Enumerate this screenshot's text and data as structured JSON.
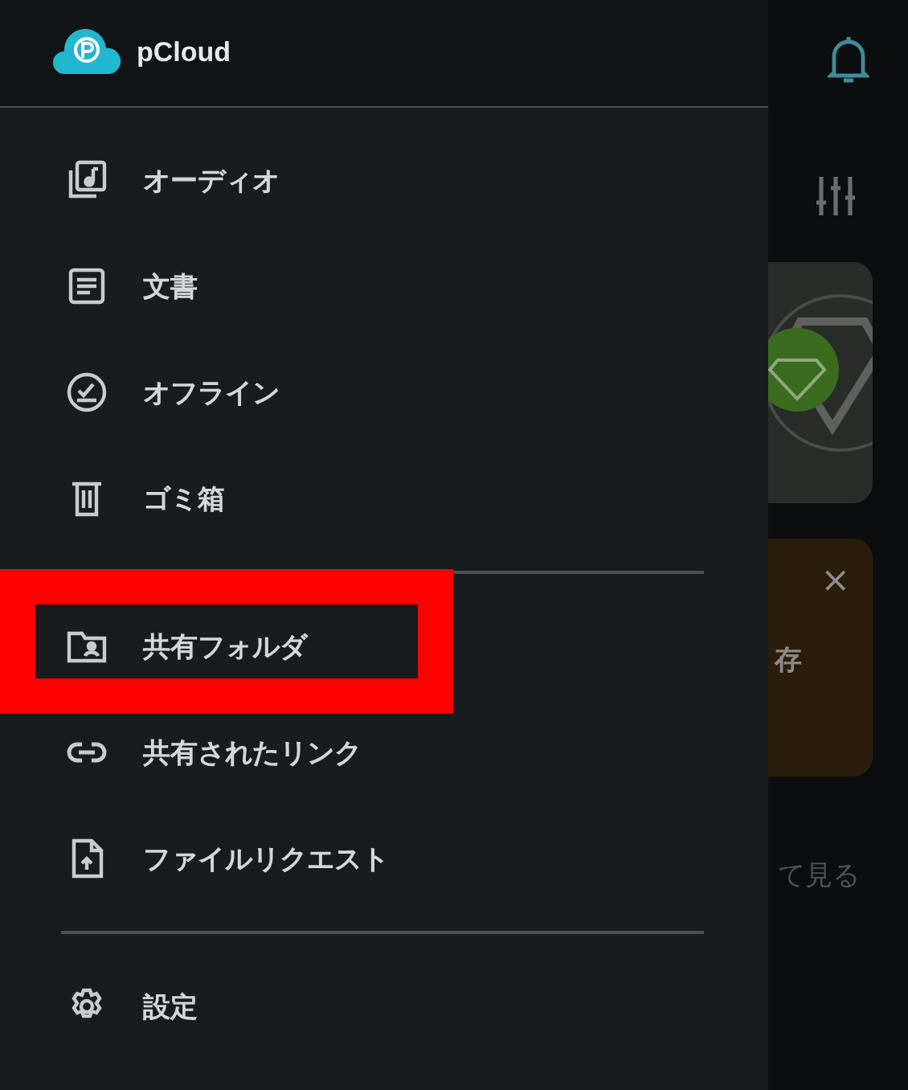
{
  "drawer": {
    "logo": "pCloud",
    "groups": [
      {
        "items": [
          {
            "label": "オーディオ",
            "kind": "audio",
            "highlighted": false
          },
          {
            "label": "文書",
            "kind": "document",
            "highlighted": false
          },
          {
            "label": "オフライン",
            "kind": "offline",
            "highlighted": false
          },
          {
            "label": "ゴミ箱",
            "kind": "trash",
            "highlighted": false
          }
        ]
      },
      {
        "items": [
          {
            "label": "共有フォルダ",
            "kind": "shared-folder",
            "highlighted": true
          },
          {
            "label": "共有されたリンク",
            "kind": "link",
            "highlighted": false
          },
          {
            "label": "ファイルリクエスト",
            "kind": "file-request",
            "highlighted": false
          }
        ]
      },
      {
        "items": [
          {
            "label": "設定",
            "kind": "settings",
            "highlighted": false
          }
        ]
      }
    ]
  },
  "background": {
    "banner_close": "×",
    "banner_text": "存",
    "link_text": "て見る"
  }
}
